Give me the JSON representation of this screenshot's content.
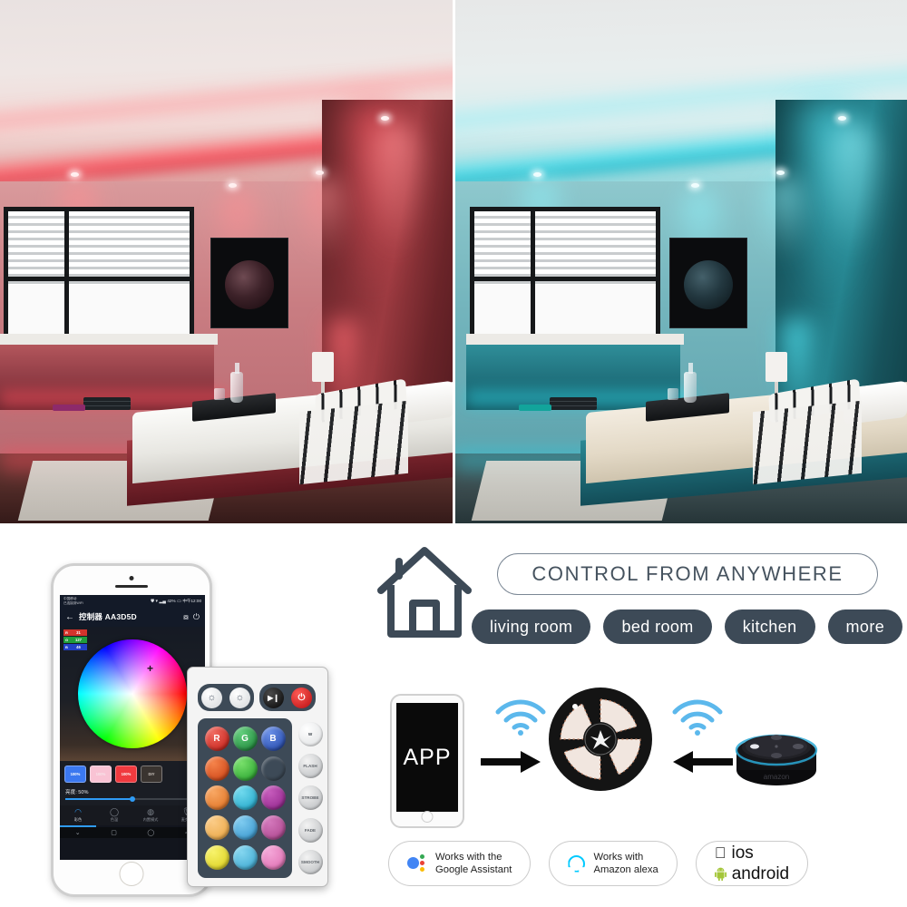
{
  "hero": {
    "left_scene": {
      "name": "bedroom-red-lighting",
      "accent_color": "#e03a48",
      "description": "Bedroom with red LED cove lighting"
    },
    "right_scene": {
      "name": "bedroom-cyan-lighting",
      "accent_color": "#18b6c8",
      "description": "Bedroom with cyan LED cove lighting"
    }
  },
  "app": {
    "statusbar": {
      "carrier_line1": "中国移动",
      "carrier_line2": "已连接到WiFi",
      "battery": "42%",
      "clock": "中午12:00",
      "icons": [
        "shield-icon",
        "wifi-icon",
        "signal-icon",
        "battery-icon"
      ]
    },
    "appbar": {
      "back": "←",
      "title": "控制器 AA3D5D",
      "timer_icon": "timer-icon",
      "power_icon": "power-icon"
    },
    "rgb": [
      {
        "channel": "R",
        "value": "31",
        "color": "#d3342c"
      },
      {
        "channel": "G",
        "value": "127",
        "color": "#1f9d3c"
      },
      {
        "channel": "B",
        "value": "46",
        "color": "#2240c8"
      }
    ],
    "color_wheel": {
      "name": "hsv-color-wheel",
      "cursor": "+"
    },
    "swatches": [
      {
        "label": "100%",
        "color": "#3b78f0"
      },
      {
        "label": "100%",
        "color": "#f9c3d4"
      },
      {
        "label": "100%",
        "color": "#f03a3f"
      },
      {
        "label": "DIY",
        "color": "#3a3430"
      }
    ],
    "brightness_label": "亮度: 50%",
    "brightness_value": 50,
    "tabs": [
      {
        "label": "彩色",
        "icon": "rainbow-icon",
        "active": true
      },
      {
        "label": "色温",
        "icon": "circle-icon",
        "active": false
      },
      {
        "label": "内置模式",
        "icon": "pattern-icon",
        "active": false
      },
      {
        "label": "麦克风",
        "icon": "microphone-icon",
        "active": false
      }
    ],
    "navbar": [
      "back-nav",
      "square-nav",
      "circle-nav",
      "triangle-nav"
    ]
  },
  "remote": {
    "top_buttons": [
      {
        "name": "brightness-up-button",
        "glyph": "☼"
      },
      {
        "name": "brightness-down-button",
        "glyph": "☼"
      },
      {
        "name": "play-pause-button",
        "glyph": "▶❙"
      },
      {
        "name": "power-button",
        "glyph": "⏻"
      }
    ],
    "color_grid": [
      [
        {
          "label": "R",
          "color": "#e03028"
        },
        {
          "label": "G",
          "color": "#30a84e"
        },
        {
          "label": "B",
          "color": "#2d5ec8"
        }
      ],
      [
        {
          "label": "",
          "color": "#ec5a1e"
        },
        {
          "label": "",
          "color": "#3fc44a"
        },
        {
          "label": "",
          "color": "#3f8eea"
        }
      ],
      [
        {
          "label": "",
          "color": "#f0883c"
        },
        {
          "label": "",
          "color": "#3fc3e0"
        },
        {
          "label": "",
          "color": "#b03fa8"
        }
      ],
      [
        {
          "label": "",
          "color": "#f6b55c"
        },
        {
          "label": "",
          "color": "#4fb6e4"
        },
        {
          "label": "",
          "color": "#c459a6"
        }
      ],
      [
        {
          "label": "",
          "color": "#f2ea2c"
        },
        {
          "label": "",
          "color": "#57c7e8"
        },
        {
          "label": "",
          "color": "#e884c4"
        }
      ]
    ],
    "white_button": {
      "label": "W"
    },
    "function_buttons": [
      "FLASH",
      "STROBE",
      "FADE",
      "SMOOTH"
    ]
  },
  "control_section": {
    "house_icon": "house-icon",
    "banner": "CONTROL FROM ANYWHERE",
    "rooms": [
      "living room",
      "bed room",
      "kitchen",
      "more"
    ]
  },
  "diagram": {
    "phone_label": "APP",
    "wifi_left_icon": "wifi-signal-icon",
    "wifi_right_icon": "wifi-signal-icon",
    "arrow_right_icon": "arrow-right-icon",
    "arrow_left_icon": "arrow-left-icon",
    "led_reel_icon": "led-strip-reel",
    "echo_label": "amazon",
    "echo_icon": "amazon-echo-dot"
  },
  "badges": [
    {
      "name": "google-assistant-badge",
      "icon": "google-assistant-icon",
      "line1": "Works  with the",
      "line2": "Google Assistant"
    },
    {
      "name": "amazon-alexa-badge",
      "icon": "alexa-icon",
      "line1": "Works with",
      "line2": "Amazon alexa"
    },
    {
      "name": "platform-badge",
      "ios_icon": "apple-icon",
      "ios_label": "ios",
      "android_icon": "android-icon",
      "android_label": "android"
    }
  ]
}
